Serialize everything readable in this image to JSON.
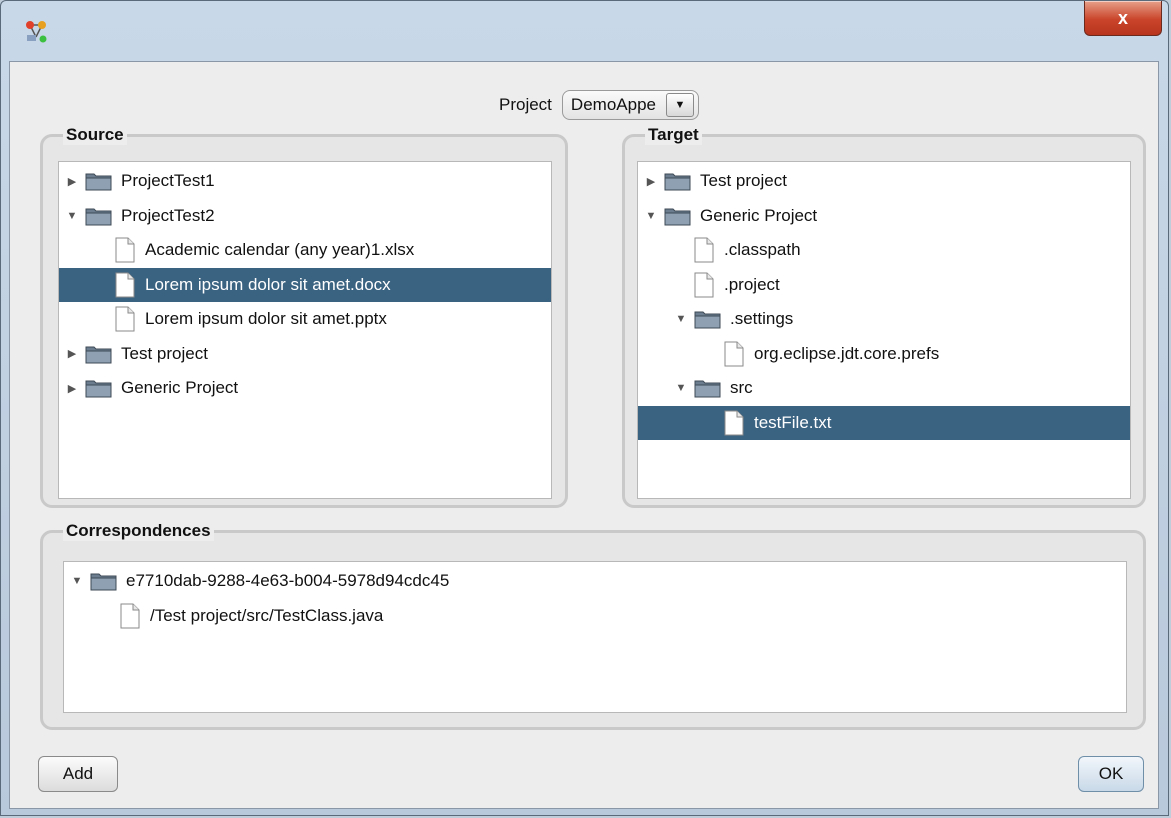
{
  "window": {
    "close_label": "x"
  },
  "project": {
    "label": "Project",
    "selected": "DemoAppe"
  },
  "source": {
    "title": "Source",
    "nodes": [
      {
        "label": "ProjectTest1",
        "type": "folder",
        "level": 0,
        "state": "collapsed",
        "selected": false
      },
      {
        "label": "ProjectTest2",
        "type": "folder",
        "level": 0,
        "state": "expanded",
        "selected": false
      },
      {
        "label": "Academic calendar (any year)1.xlsx",
        "type": "file",
        "level": 1,
        "selected": false
      },
      {
        "label": "Lorem ipsum dolor sit amet.docx",
        "type": "file",
        "level": 1,
        "selected": true
      },
      {
        "label": "Lorem ipsum dolor sit amet.pptx",
        "type": "file",
        "level": 1,
        "selected": false
      },
      {
        "label": "Test project",
        "type": "folder",
        "level": 0,
        "state": "collapsed",
        "selected": false
      },
      {
        "label": "Generic Project",
        "type": "folder",
        "level": 0,
        "state": "collapsed",
        "selected": false
      }
    ]
  },
  "target": {
    "title": "Target",
    "nodes": [
      {
        "label": "Test project",
        "type": "folder",
        "level": 0,
        "state": "collapsed",
        "selected": false
      },
      {
        "label": "Generic Project",
        "type": "folder",
        "level": 0,
        "state": "expanded",
        "selected": false
      },
      {
        "label": ".classpath",
        "type": "file",
        "level": 1,
        "selected": false
      },
      {
        "label": ".project",
        "type": "file",
        "level": 1,
        "selected": false
      },
      {
        "label": ".settings",
        "type": "folder",
        "level": 1,
        "state": "expanded",
        "selected": false
      },
      {
        "label": "org.eclipse.jdt.core.prefs",
        "type": "file",
        "level": 2,
        "selected": false
      },
      {
        "label": "src",
        "type": "folder",
        "level": 1,
        "state": "expanded",
        "selected": false
      },
      {
        "label": "testFile.txt",
        "type": "file",
        "level": 2,
        "selected": true
      }
    ]
  },
  "correspondences": {
    "title": "Correspondences",
    "nodes": [
      {
        "label": "e7710dab-9288-4e63-b004-5978d94cdc45",
        "type": "folder",
        "level": 0,
        "state": "expanded",
        "selected": false
      },
      {
        "label": "/Test project/src/TestClass.java",
        "type": "file",
        "level": 1,
        "selected": false
      }
    ]
  },
  "buttons": {
    "add": "Add",
    "ok": "OK"
  },
  "colors": {
    "selection": "#3a6281",
    "close_button": "#c9442a"
  }
}
